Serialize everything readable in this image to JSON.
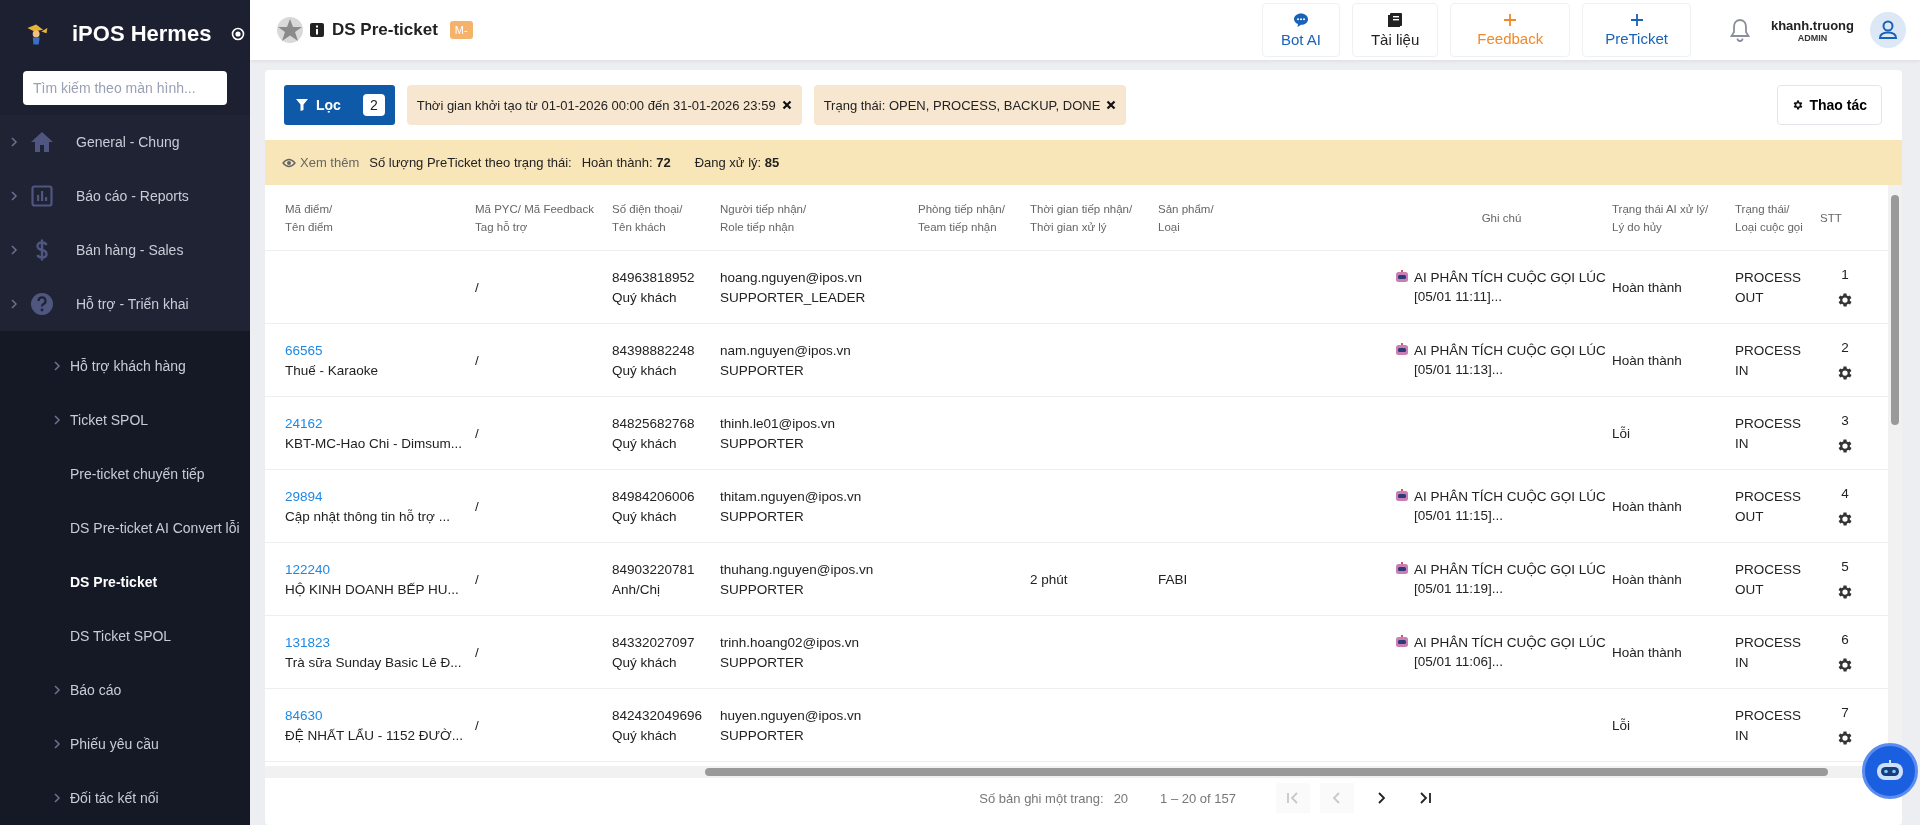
{
  "sidebar": {
    "app_title": "iPOS Hermes",
    "search": {
      "placeholder": "Tìm kiếm theo màn hình..."
    },
    "items": [
      {
        "label": "General - Chung"
      },
      {
        "label": "Báo cáo - Reports"
      },
      {
        "label": "Bán hàng - Sales"
      },
      {
        "label": "Hỗ trợ - Triển khai",
        "children": [
          {
            "label": "Hỗ trợ khách hàng",
            "has_children": true,
            "selected": false
          },
          {
            "label": "Ticket SPOL",
            "has_children": true,
            "selected": false
          },
          {
            "label": "Pre-ticket chuyển tiếp",
            "has_children": false,
            "selected": false
          },
          {
            "label": "DS Pre-ticket AI Convert lỗi",
            "has_children": false,
            "selected": false
          },
          {
            "label": "DS Pre-ticket",
            "has_children": false,
            "selected": true
          },
          {
            "label": "DS Ticket SPOL",
            "has_children": false,
            "selected": false
          },
          {
            "label": "Báo cáo",
            "has_children": true,
            "selected": false
          },
          {
            "label": "Phiếu yêu cầu",
            "has_children": true,
            "selected": false
          },
          {
            "label": "Đối tác kết nối",
            "has_children": true,
            "selected": false
          }
        ]
      }
    ]
  },
  "header": {
    "title": "DS Pre-ticket",
    "badge": "M-",
    "buttons": [
      {
        "label": "Bot AI",
        "kind": "chat"
      },
      {
        "label": "Tài liệu",
        "kind": "docs"
      },
      {
        "label": "Feedback",
        "kind": "plus-orange"
      },
      {
        "label": "PreTicket",
        "kind": "plus-blue"
      }
    ],
    "user": {
      "name": "khanh.truong",
      "role": "ADMIN"
    }
  },
  "filters": {
    "button": {
      "label": "Lọc",
      "count": "2"
    },
    "chips": [
      "Thời gian khởi tạo từ 01-01-2026 00:00 đến 31-01-2026 23:59",
      "Trạng thái: OPEN, PROCESS, BACKUP, DONE"
    ],
    "actions_button": "Thao tác"
  },
  "summary": {
    "link": "Xem thêm",
    "label": "Số lượng PreTicket theo trạng thái:",
    "counts": [
      "Hoàn thành: **72**",
      "Đang xử lý: **85**"
    ]
  },
  "table": {
    "columns": [
      "Mã điểm/\nTên điểm",
      "Mã PYC/ Mã Feedback\nTag hỗ trợ",
      "Số điện thoại/\nTên khách",
      "Người tiếp nhận/\nRole tiếp nhận",
      "Phòng tiếp nhận/\nTeam tiếp nhận",
      "Thời gian tiếp nhận/\nThời gian xử lý",
      "Sản phẩm/\nLoại",
      "Ghi chú",
      "Trạng thái AI xử lý/\nLý do hủy",
      "Trạng thái/\nLoại cuộc gọi",
      "STT"
    ],
    "rows": [
      {
        "code": "",
        "store": "",
        "pyc": "/",
        "phone": "84963818952",
        "customer": "Quý khách",
        "receiver": "hoang.nguyen@ipos.vn",
        "role": "SUPPORTER_LEADER",
        "time": "",
        "product": "",
        "note": "AI PHÂN TÍCH CUỘC GỌI LÚC [05/01 11:11]...",
        "ai_status": "Hoàn thành",
        "status": "PROCESS",
        "call_type": "OUT",
        "stt": "1"
      },
      {
        "code": "66565",
        "store": "Thuế - Karaoke",
        "pyc": "/",
        "phone": "84398882248",
        "customer": "Quý khách",
        "receiver": "nam.nguyen@ipos.vn",
        "role": "SUPPORTER",
        "time": "",
        "product": "",
        "note": "AI PHÂN TÍCH CUỘC GỌI LÚC [05/01 11:13]...",
        "ai_status": "Hoàn thành",
        "status": "PROCESS",
        "call_type": "IN",
        "stt": "2"
      },
      {
        "code": "24162",
        "store": "KBT-MC-Hao Chi - Dimsum...",
        "pyc": "/",
        "phone": "84825682768",
        "customer": "Quý khách",
        "receiver": "thinh.le01@ipos.vn",
        "role": "SUPPORTER",
        "time": "",
        "product": "",
        "note": "",
        "ai_status": "Lỗi",
        "status": "PROCESS",
        "call_type": "IN",
        "stt": "3"
      },
      {
        "code": "29894",
        "store": "Cập nhật thông tin hỗ trợ ...",
        "pyc": "/",
        "phone": "84984206006",
        "customer": "Quý khách",
        "receiver": "thitam.nguyen@ipos.vn",
        "role": "SUPPORTER",
        "time": "",
        "product": "",
        "note": "AI PHÂN TÍCH CUỘC GỌI LÚC [05/01 11:15]...",
        "ai_status": "Hoàn thành",
        "status": "PROCESS",
        "call_type": "OUT",
        "stt": "4"
      },
      {
        "code": "122240",
        "store": "HỘ KINH DOANH BẾP HU...",
        "pyc": "/",
        "phone": "84903220781",
        "customer": "Anh/Chị",
        "receiver": "thuhang.nguyen@ipos.vn",
        "role": "SUPPORTER",
        "time": "2 phút",
        "product": "FABI",
        "note": "AI PHÂN TÍCH CUỘC GỌI LÚC [05/01 11:19]...",
        "ai_status": "Hoàn thành",
        "status": "PROCESS",
        "call_type": "OUT",
        "stt": "5"
      },
      {
        "code": "131823",
        "store": "Trà sữa Sunday Basic Lê Đ...",
        "pyc": "/",
        "phone": "84332027097",
        "customer": "Quý khách",
        "receiver": "trinh.hoang02@ipos.vn",
        "role": "SUPPORTER",
        "time": "",
        "product": "",
        "note": "AI PHÂN TÍCH CUỘC GỌI LÚC [05/01 11:06]...",
        "ai_status": "Hoàn thành",
        "status": "PROCESS",
        "call_type": "IN",
        "stt": "6"
      },
      {
        "code": "84630",
        "store": "ĐỆ NHẤT LẨU - 1152 ĐƯỜ...",
        "pyc": "/",
        "phone": "842432049696",
        "customer": "Quý khách",
        "receiver": "huyen.nguyen@ipos.vn",
        "role": "SUPPORTER",
        "time": "",
        "product": "",
        "note": "",
        "ai_status": "Lỗi",
        "status": "PROCESS",
        "call_type": "IN",
        "stt": "7"
      }
    ]
  },
  "pagination": {
    "page_size_label": "Số bản ghi một trang:",
    "page_size": "20",
    "range": "1 – 20 of 157",
    "controls": [
      {
        "kind": "first",
        "disabled": true
      },
      {
        "kind": "prev",
        "disabled": true
      },
      {
        "kind": "next",
        "disabled": false
      },
      {
        "kind": "last",
        "disabled": false
      }
    ]
  }
}
